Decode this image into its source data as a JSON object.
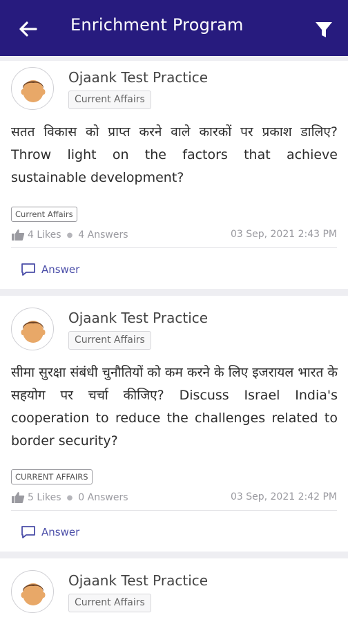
{
  "appbar": {
    "title": "Enrichment Program",
    "back_icon": "arrow-left-icon",
    "filter_icon": "funnel-filter-icon",
    "background": "#271b7e"
  },
  "posts": [
    {
      "author": "Ojaank Test Practice",
      "category": "Current Affairs",
      "question": "सतत विकास को प्राप्त करने वाले कारकों पर प्रकाश डालिए? Throw light on the factors that achieve sustainable development?",
      "tag": "Current Affairs",
      "likes": "4 Likes",
      "answers": "4 Answers",
      "date": "03 Sep, 2021 2:43 PM",
      "answer_label": "Answer"
    },
    {
      "author": "Ojaank Test Practice",
      "category": "Current Affairs",
      "question": "सीमा सुरक्षा संबंधी चुनौतियों को कम करने के लिए इजरायल भारत के सहयोग पर चर्चा कीजिए? Discuss Israel India's cooperation to reduce the challenges related to border security?",
      "tag": "CURRENT AFFAIRS",
      "likes": "5 Likes",
      "answers": "0 Answers",
      "date": "03 Sep, 2021 2:42 PM",
      "answer_label": "Answer"
    },
    {
      "author": "Ojaank Test Practice",
      "category": "Current Affairs"
    }
  ],
  "colors": {
    "accent": "#4a4da8",
    "text_muted": "#9a9aa0"
  }
}
